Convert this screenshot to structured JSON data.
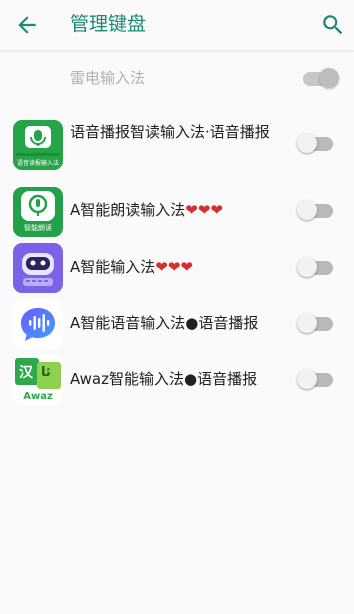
{
  "appbar": {
    "title": "管理键盘",
    "back_icon": "arrow-left-icon",
    "search_icon": "search-icon",
    "accent_color": "#1a8a73"
  },
  "keyboards": [
    {
      "label": "雷电输入法",
      "enabled": true,
      "disabled_row": true,
      "icon": ""
    },
    {
      "label": "语音播报智读输入法·语音播报",
      "enabled": false,
      "icon": "voice-reader-keyboard-icon",
      "icon_caption": "语音读报输入法"
    },
    {
      "label": "A智能朗读输入法",
      "suffix": "❤❤❤",
      "enabled": false,
      "icon": "smart-read-aloud-icon",
      "icon_caption": "智能朗读"
    },
    {
      "label": "A智能输入法",
      "suffix": "❤❤❤",
      "enabled": false,
      "icon": "robot-keyboard-icon"
    },
    {
      "label": "A智能语音输入法",
      "separator": "●",
      "label_tail": "语音播报",
      "enabled": false,
      "icon": "voice-wave-bubble-icon"
    },
    {
      "label": "Awaz智能输入法",
      "separator": "●",
      "label_tail": "语音播报",
      "enabled": false,
      "icon": "awaz-keyboard-icon",
      "icon_caption": "Awaz",
      "icon_glyphs": [
        "汉",
        "ئا"
      ]
    }
  ]
}
